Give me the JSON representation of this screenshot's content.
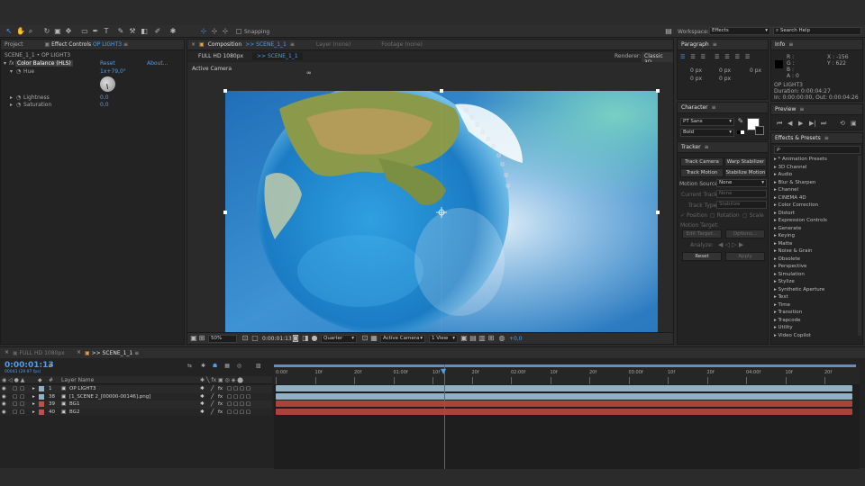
{
  "toolbar": {
    "snapping_label": "Snapping",
    "workspace_label": "Workspace:",
    "workspace_value": "Effects",
    "search_placeholder": "Search Help"
  },
  "project_panel": {
    "tab_project": "Project",
    "tab_effect_controls": "Effect Controls",
    "effect_controls_layer": "OP LIGHT3"
  },
  "effect_controls": {
    "breadcrumb": "SCENE_1_1 • OP LIGHT3",
    "effect_name": "Color Balance (HLS)",
    "reset_label": "Reset",
    "about_label": "About...",
    "hue_label": "Hue",
    "hue_value": "1x+79,0°",
    "lightness_label": "Lightness",
    "lightness_value": "0,0",
    "saturation_label": "Saturation",
    "saturation_value": "0,0"
  },
  "composition": {
    "panel_label": "Composition",
    "comp_name": ">> SCENE_1_1",
    "layer_tab": "Layer (none)",
    "footage_tab": "Footage (none)",
    "tabs": [
      "FULL HD 1080px",
      ">> SCENE_1_1"
    ],
    "renderer_label": "Renderer:",
    "renderer_value": "Classic 3D",
    "active_camera_label": "Active Camera",
    "zoom_value": "50%",
    "timecode": "0:00:01:13",
    "resolution_value": "Quarter",
    "camera_value": "Active Camera",
    "view_value": "1 View",
    "exposure_value": "+0,0"
  },
  "paragraph": {
    "title": "Paragraph",
    "indent_values": [
      "0 px",
      "0 px",
      "0 px",
      "0 px",
      "0 px"
    ]
  },
  "character": {
    "title": "Character",
    "font": "PT Sans",
    "style": "Bold"
  },
  "tracker": {
    "title": "Tracker",
    "buttons": [
      "Track Camera",
      "Warp Stabilizer",
      "Track Motion",
      "Stabilize Motion"
    ],
    "motion_source_label": "Motion Source:",
    "motion_source_value": "None",
    "current_track_label": "Current Track:",
    "current_track_value": "None",
    "track_type_label": "Track Type:",
    "track_type_value": "Stabilize",
    "options": [
      "Position",
      "Rotation",
      "Scale"
    ],
    "motion_target_label": "Motion Target:",
    "edit_target_label": "Edit Target...",
    "options_label": "Options...",
    "analyze_label": "Analyze:",
    "reset_label": "Reset",
    "apply_label": "Apply"
  },
  "info": {
    "title": "Info",
    "r_label": "R :",
    "g_label": "G :",
    "b_label": "B :",
    "a_label": "A : 0",
    "x_value": "X : -156",
    "y_value": "Y : 622",
    "layer_name": "OP LIGHT3",
    "duration": "Duration: 0:00:04:27",
    "in_out": "In: 0:00:00:00, Out: 0:00:04:26"
  },
  "preview": {
    "title": "Preview"
  },
  "effects_presets": {
    "title": "Effects & Presets",
    "search_placeholder": "ρ·",
    "items": [
      "* Animation Presets",
      "3D Channel",
      "Audio",
      "Blur & Sharpen",
      "Channel",
      "CINEMA 4D",
      "Color Correction",
      "Distort",
      "Expression Controls",
      "Generate",
      "Keying",
      "Matte",
      "Noise & Grain",
      "Obsolete",
      "Perspective",
      "Simulation",
      "Stylize",
      "Synthetic Aperture",
      "Text",
      "Time",
      "Transition",
      "Trapcode",
      "Utility",
      "Video Copilot"
    ]
  },
  "timeline": {
    "tabs": [
      "FULL HD 1080px",
      ">> SCENE_1_1"
    ],
    "timecode": "0:00:01:13",
    "frame_info": "00043 (29.97 fps)",
    "search_placeholder": "ρ·",
    "col_hash": "#",
    "col_layer_name": "Layer Name",
    "layers": [
      {
        "num": "1",
        "name": "OP LIGHT3",
        "color": "#8fb1c2"
      },
      {
        "num": "38",
        "name": "[1_SCENE 2_[00000-00146].png]",
        "color": "#8fb1c2"
      },
      {
        "num": "39",
        "name": "BG1",
        "color": "#c0504d"
      },
      {
        "num": "40",
        "name": "BG2",
        "color": "#c0504d"
      }
    ],
    "ruler_labels": [
      "0:00f",
      "10f",
      "20f",
      "01:00f",
      "10f",
      "20f",
      "02:00f",
      "10f",
      "20f",
      "03:00f",
      "10f",
      "20f",
      "04:00f",
      "10f",
      "20f"
    ]
  },
  "colors": {
    "accent": "#4f9df0",
    "layer_blue": "#8fb1c2",
    "layer_red": "#a8443c",
    "playhead": "#d33b2c"
  }
}
